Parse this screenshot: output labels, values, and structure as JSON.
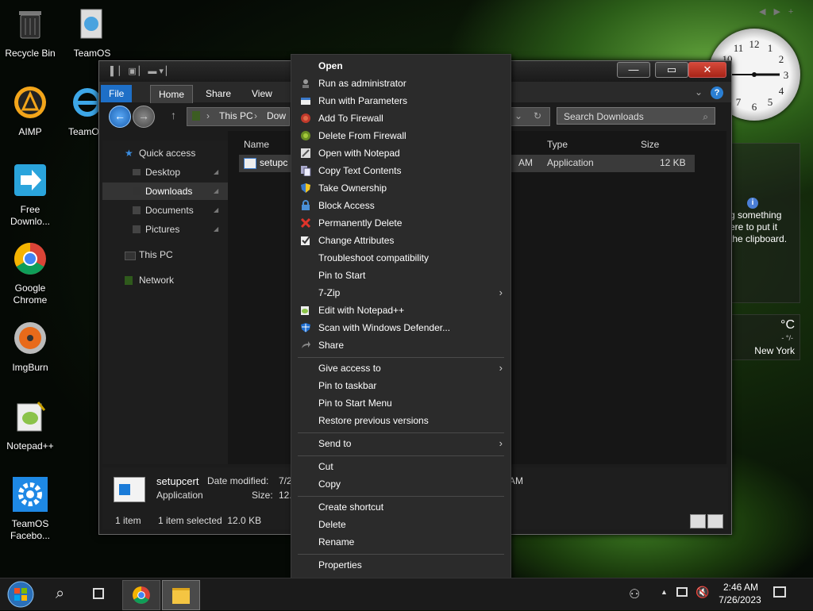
{
  "desktop": {
    "icons": [
      {
        "label": "Recycle Bin"
      },
      {
        "label": "TeamOS"
      },
      {
        "label": "AIMP"
      },
      {
        "label": "TeamO"
      },
      {
        "label": "Free Downlo..."
      },
      {
        "label": "Google Chrome"
      },
      {
        "label": "ImgBurn"
      },
      {
        "label": "Notepad++"
      },
      {
        "label": "TeamOS Facebo..."
      }
    ]
  },
  "gadgets": {
    "clipboard_text": "g something\nere to put it\nthe clipboard.",
    "weather_unit": "°C",
    "weather_sub": "- °/-",
    "weather_city": "New York"
  },
  "explorer": {
    "tabs": [
      "File",
      "Home",
      "Share",
      "View"
    ],
    "address": {
      "root": "This PC",
      "current": "Dow"
    },
    "search_placeholder": "Search Downloads",
    "nav": {
      "quick_access": "Quick access",
      "desktop": "Desktop",
      "downloads": "Downloads",
      "documents": "Documents",
      "pictures": "Pictures",
      "this_pc": "This PC",
      "network": "Network"
    },
    "columns": {
      "name": "Name",
      "type": "Type",
      "size": "Size"
    },
    "file": {
      "name": "setupc",
      "time_frag": "AM",
      "type": "Application",
      "size": "12 KB"
    },
    "details": {
      "name": "setupcert",
      "kind": "Application",
      "date_label": "Date modified:",
      "date_value": "7/2",
      "size_label": "Size:",
      "size_value": "12.",
      "right_frag": "AM"
    },
    "status": {
      "count": "1 item",
      "selection": "1 item selected  12.0 KB"
    }
  },
  "context_menu": {
    "items": [
      {
        "label": "Open"
      },
      {
        "label": "Run as administrator"
      },
      {
        "label": "Run with Parameters"
      },
      {
        "label": "Add To Firewall"
      },
      {
        "label": "Delete From Firewall"
      },
      {
        "label": "Open with Notepad"
      },
      {
        "label": "Copy Text Contents"
      },
      {
        "label": "Take Ownership"
      },
      {
        "label": "Block Access"
      },
      {
        "label": "Permanently Delete"
      },
      {
        "label": "Change Attributes"
      },
      {
        "label": "Troubleshoot compatibility"
      },
      {
        "label": "Pin to Start"
      },
      {
        "label": "7-Zip"
      },
      {
        "label": "Edit with Notepad++"
      },
      {
        "label": "Scan with Windows Defender..."
      },
      {
        "label": "Share"
      },
      {
        "label": "Give access to"
      },
      {
        "label": "Pin to taskbar"
      },
      {
        "label": "Pin to Start Menu"
      },
      {
        "label": "Restore previous versions"
      },
      {
        "label": "Send to"
      },
      {
        "label": "Cut"
      },
      {
        "label": "Copy"
      },
      {
        "label": "Create shortcut"
      },
      {
        "label": "Delete"
      },
      {
        "label": "Rename"
      },
      {
        "label": "Properties"
      }
    ]
  },
  "taskbar": {
    "time": "2:46 AM",
    "date": "7/26/2023"
  }
}
